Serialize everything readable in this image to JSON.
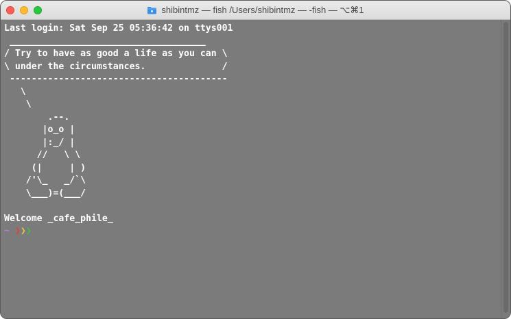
{
  "window": {
    "title": "shibintmz — fish /Users/shibintmz — -fish — ⌥⌘1",
    "folder_icon_color": "#3a8ee6"
  },
  "terminal": {
    "background": "#7b7b7b",
    "lines": [
      "Last login: Sat Sep 25 05:36:42 on ttys001",
      " ____________________________________",
      "/ Try to have as good a life as you can \\",
      "\\ under the circumstances.              /",
      " ----------------------------------------",
      "   \\",
      "    \\",
      "        .--.",
      "       |o_o |",
      "       |:_/ |",
      "      //   \\ \\",
      "     (|     | )",
      "    /'\\_   _/`\\",
      "    \\___)=(___/",
      "",
      "Welcome _cafe_phile_"
    ],
    "prompt": {
      "tilde": "~",
      "arrows": [
        "❯",
        "❯",
        "❯"
      ],
      "colors": [
        "#e2413b",
        "#e9c24a",
        "#3fbf4f"
      ]
    }
  }
}
